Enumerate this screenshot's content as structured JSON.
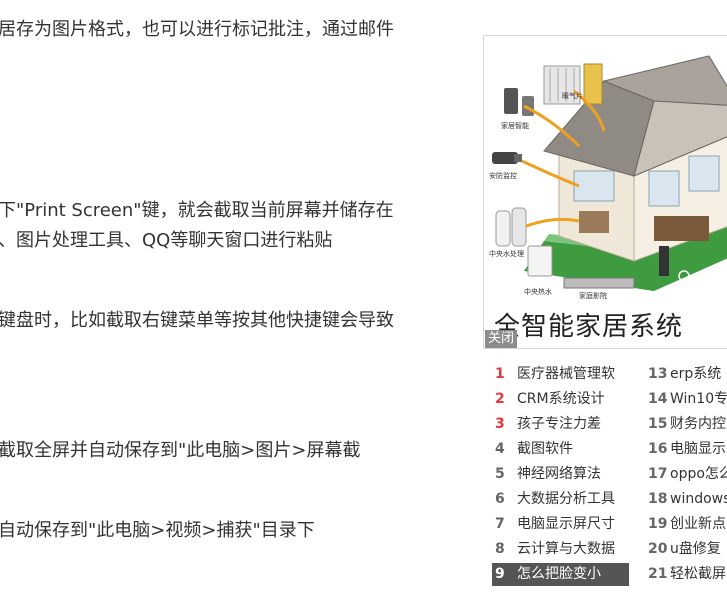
{
  "article": {
    "lines": [
      "居存为图片格式，也可以进行标记批注，通过邮件",
      "下\"Print Screen\"键，就会截取当前屏幕并储存在",
      "、图片处理工具、QQ等聊天窗口进行粘贴",
      "键盘时，比如截取右键菜单等按其他快捷键会导致",
      "截取全屏并自动保存到\"此电脑>图片>屏幕截",
      "自动保存到\"此电脑>视频>捕获\"目录下"
    ]
  },
  "ad": {
    "title": "全智能家居系统",
    "close_label": "关闭",
    "image_labels": [
      "暖气片",
      "家居智能",
      "安防监控",
      "中央水处理",
      "中央热水",
      "家庭影院"
    ]
  },
  "hot_list": {
    "col1": [
      {
        "num": "1",
        "text": "医疗器械管理软"
      },
      {
        "num": "2",
        "text": "CRM系统设计"
      },
      {
        "num": "3",
        "text": "孩子专注力差"
      },
      {
        "num": "4",
        "text": "截图软件"
      },
      {
        "num": "5",
        "text": "神经网络算法"
      },
      {
        "num": "6",
        "text": "大数据分析工具"
      },
      {
        "num": "7",
        "text": "电脑显示屏尺寸"
      },
      {
        "num": "8",
        "text": "云计算与大数据"
      },
      {
        "num": "9",
        "text": "怎么把脸变小"
      }
    ],
    "col2": [
      {
        "num": "13",
        "text": "erp系统"
      },
      {
        "num": "14",
        "text": "Win10专"
      },
      {
        "num": "15",
        "text": "财务内控"
      },
      {
        "num": "16",
        "text": "电脑显示"
      },
      {
        "num": "17",
        "text": "oppo怎么"
      },
      {
        "num": "18",
        "text": "windows"
      },
      {
        "num": "19",
        "text": "创业新点"
      },
      {
        "num": "20",
        "text": "u盘修复"
      },
      {
        "num": "21",
        "text": "轻松截屏"
      }
    ]
  }
}
